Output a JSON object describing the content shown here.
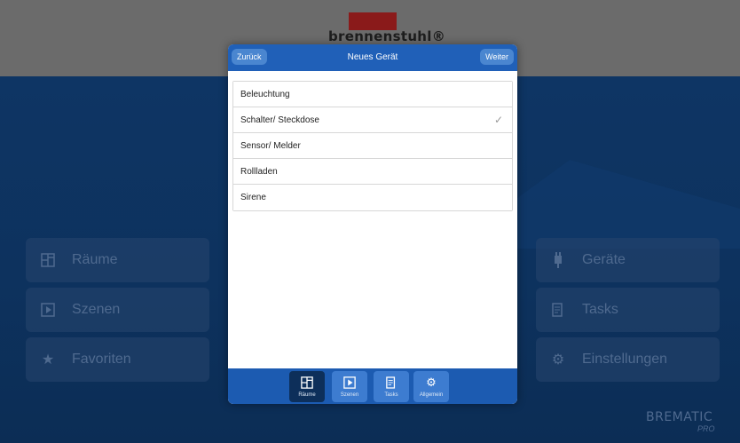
{
  "header": {
    "brand": "brennenstuhl®"
  },
  "background_tiles": {
    "left": [
      {
        "label": "Räume",
        "icon": "rooms-icon"
      },
      {
        "label": "Szenen",
        "icon": "play-icon"
      },
      {
        "label": "Favoriten",
        "icon": "star-icon"
      }
    ],
    "right": [
      {
        "label": "Geräte",
        "icon": "plug-icon"
      },
      {
        "label": "Tasks",
        "icon": "tasks-icon"
      },
      {
        "label": "Einstellungen",
        "icon": "gears-icon"
      }
    ]
  },
  "bottom_logo": {
    "text": "BREMATIC",
    "sub": "PRO"
  },
  "modal": {
    "title": "Neues Gerät",
    "back_label": "Zurück",
    "next_label": "Weiter",
    "items": [
      {
        "label": "Beleuchtung",
        "checked": false
      },
      {
        "label": "Schalter/ Steckdose",
        "checked": true
      },
      {
        "label": "Sensor/ Melder",
        "checked": false
      },
      {
        "label": "Rollladen",
        "checked": false
      },
      {
        "label": "Sirene",
        "checked": false
      }
    ],
    "check_glyph": "✓",
    "tabs": [
      {
        "label": "Räume",
        "icon": "rooms-icon",
        "active": true
      },
      {
        "label": "Szenen",
        "icon": "play-icon",
        "active": false
      },
      {
        "label": "Tasks",
        "icon": "tasks-icon",
        "active": false
      },
      {
        "label": "Allgemein",
        "icon": "gears-icon",
        "active": false
      }
    ]
  },
  "colors": {
    "header_blue": "#2060b8",
    "background": "#0e3564",
    "topbar": "#6b6b6b"
  }
}
